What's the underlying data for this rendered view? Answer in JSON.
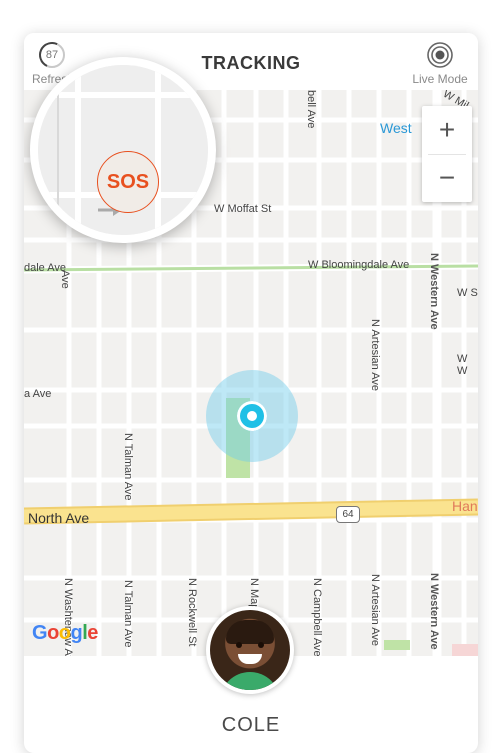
{
  "header": {
    "title": "TRACKING",
    "refresh_label": "Refresh",
    "refresh_count": "87",
    "live_mode_label": "Live Mode"
  },
  "map": {
    "streets": {
      "w_moffat": "W Moffat St",
      "w_bloomingdale": "W Bloomingdale Ave",
      "bloomingdale_left": "dale Ave",
      "w_left": "W S",
      "w_w": "W W",
      "ave_left": "a Ave",
      "north_ave": "North Ave",
      "route": "64",
      "west": "West",
      "ham": "Han",
      "n_western": "N Western Ave",
      "n_artesian": "N Artesian Ave",
      "n_talman": "N Talman Ave",
      "n_washtenaw": "N Washtenaw Ave",
      "n_rockwell": "N Rockwell St",
      "n_maplewood": "N Maplewood",
      "n_campbell": "N Campbell Ave",
      "bell_ave": "bell Ave",
      "w_mil": "W Mil",
      "ave_top": "Ave"
    },
    "zoom_in": "+",
    "zoom_out": "−",
    "google": "Google"
  },
  "sos_label": "SOS",
  "child": {
    "name": "COLE"
  },
  "colors": {
    "sos": "#e8501f",
    "marker": "#1fc0e6",
    "north_ave": "#f7dc8a",
    "park": "#bfe3a6"
  }
}
